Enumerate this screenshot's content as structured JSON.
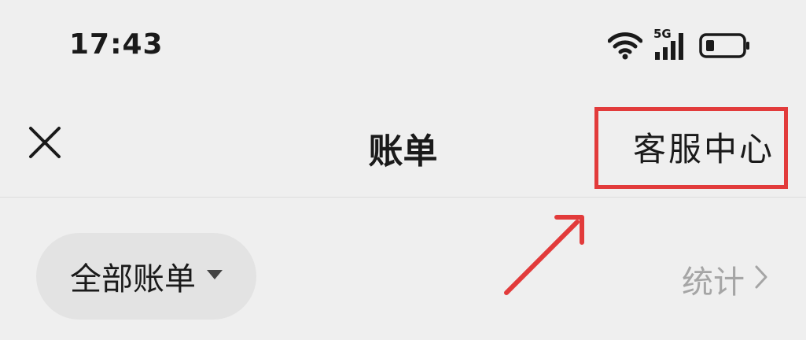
{
  "status_bar": {
    "time": "17:43",
    "network_label": "5G",
    "icons": [
      "wifi-icon",
      "cellular-signal-icon",
      "battery-icon"
    ]
  },
  "nav": {
    "title": "账单",
    "right_action": "客服中心",
    "close_icon": "close-icon"
  },
  "filter": {
    "selected": "全部账单",
    "dropdown_icon": "caret-down-icon"
  },
  "stats": {
    "label": "统计",
    "icon": "chevron-right-icon"
  },
  "colors": {
    "background": "#efefef",
    "pill_background": "#e3e3e3",
    "annotation_red": "#e23b3b",
    "muted_text": "#a5a5a5"
  }
}
